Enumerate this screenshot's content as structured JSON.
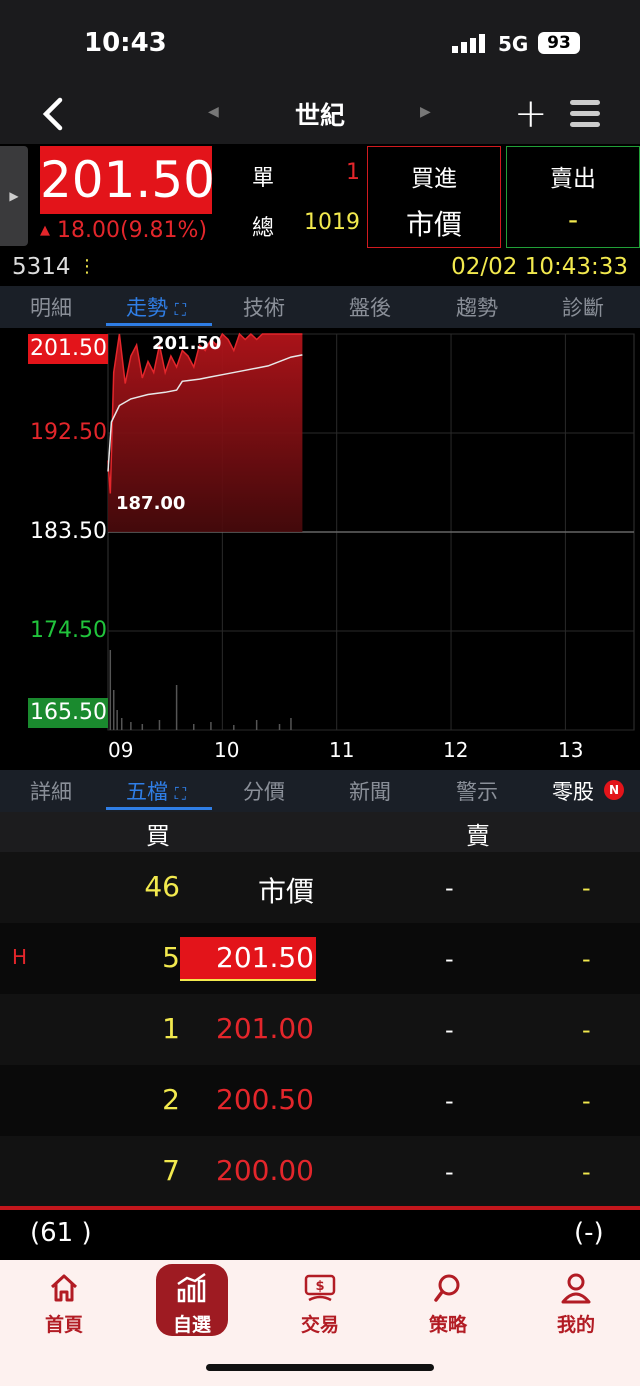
{
  "status": {
    "time": "10:43",
    "network": "5G",
    "battery": "93"
  },
  "nav": {
    "title": "世紀"
  },
  "quote": {
    "price": "201.50",
    "change": "18.00(9.81%)",
    "single_label": "單",
    "single_value": "1",
    "total_label": "總",
    "total_value": "1019",
    "buy_label": "買進",
    "buy_value": "市價",
    "sell_label": "賣出",
    "sell_value": "-",
    "code": "5314",
    "datetime": "02/02 10:43:33"
  },
  "tabs_top": [
    "明細",
    "走勢",
    "技術",
    "盤後",
    "趨勢",
    "診斷"
  ],
  "chart_data": {
    "type": "area",
    "y_ticks": [
      "201.50",
      "192.50",
      "183.50",
      "174.50",
      "165.50"
    ],
    "x_ticks": [
      "09",
      "10",
      "11",
      "12",
      "13"
    ],
    "high_label": "201.50",
    "low_label": "187.00",
    "ylim": [
      165.5,
      201.5
    ],
    "reference": 183.5,
    "price_series": {
      "x": [
        9.0,
        9.02,
        9.05,
        9.1,
        9.15,
        9.2,
        9.25,
        9.3,
        9.35,
        9.4,
        9.45,
        9.5,
        9.55,
        9.6,
        9.65,
        9.7,
        9.75,
        9.8,
        9.85,
        9.9,
        9.95,
        10.0,
        10.05,
        10.1,
        10.15,
        10.2,
        10.25,
        10.3,
        10.35,
        10.4,
        10.45,
        10.5,
        10.55,
        10.6,
        10.65,
        10.7
      ],
      "y": [
        190.0,
        187.0,
        198.0,
        201.5,
        197.0,
        199.5,
        200.5,
        197.5,
        199.0,
        198.0,
        200.5,
        198.0,
        199.5,
        198.5,
        200.0,
        199.5,
        198.5,
        200.5,
        200.0,
        201.0,
        200.5,
        201.5,
        201.0,
        200.0,
        201.5,
        201.0,
        201.5,
        201.0,
        201.5,
        201.5,
        201.5,
        201.5,
        201.5,
        201.5,
        201.5,
        201.5
      ]
    },
    "avg_series": {
      "x": [
        9.0,
        9.03,
        9.1,
        9.2,
        9.35,
        9.5,
        9.6,
        9.65,
        9.8,
        9.9,
        10.0,
        10.2,
        10.4,
        10.6,
        10.7
      ],
      "y": [
        189.0,
        193.5,
        195.0,
        195.6,
        196.0,
        196.2,
        196.4,
        197.2,
        197.4,
        197.6,
        197.8,
        198.2,
        198.6,
        199.4,
        199.6
      ]
    }
  },
  "tabs_bottom": [
    "詳細",
    "五檔",
    "分價",
    "新聞",
    "警示",
    "零股"
  ],
  "new_badge": "N",
  "book": {
    "buy_header": "買",
    "sell_header": "賣",
    "high_marker": "H",
    "rows": [
      {
        "bid_qty": "46",
        "bid_price": "市價",
        "ask_price": "-",
        "ask_qty": "-"
      },
      {
        "bid_qty": "5",
        "bid_price": "201.50",
        "ask_price": "-",
        "ask_qty": "-"
      },
      {
        "bid_qty": "1",
        "bid_price": "201.00",
        "ask_price": "-",
        "ask_qty": "-"
      },
      {
        "bid_qty": "2",
        "bid_price": "200.50",
        "ask_price": "-",
        "ask_qty": "-"
      },
      {
        "bid_qty": "7",
        "bid_price": "200.00",
        "ask_price": "-",
        "ask_qty": "-"
      }
    ],
    "bid_total": "(61 )",
    "ask_total": "(-)"
  },
  "bottom_nav": [
    "首頁",
    "自選",
    "交易",
    "策略",
    "我的"
  ],
  "colors": {
    "up": "#e3262b",
    "down": "#21a038",
    "accent": "#2f7ee6",
    "qty": "#f2e94e",
    "brand": "#9e1b22"
  }
}
